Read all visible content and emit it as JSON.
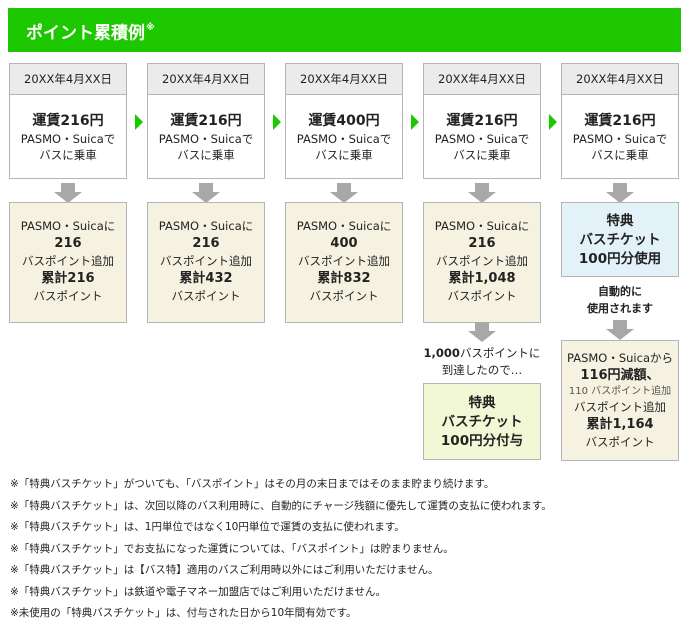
{
  "header": {
    "title": "ポイント累積例",
    "mark": "※"
  },
  "columns": [
    {
      "date": "20XX年4月XX日",
      "fare": "運賃216円",
      "line1": "PASMO・Suicaで",
      "line2": "バスに乗車",
      "r1": "PASMO・Suicaに",
      "r2": "216",
      "r3": "バスポイント追加",
      "r4": "累計216",
      "r5": "バスポイント"
    },
    {
      "date": "20XX年4月XX日",
      "fare": "運賃216円",
      "line1": "PASMO・Suicaで",
      "line2": "バスに乗車",
      "r1": "PASMO・Suicaに",
      "r2": "216",
      "r3": "バスポイント追加",
      "r4": "累計432",
      "r5": "バスポイント"
    },
    {
      "date": "20XX年4月XX日",
      "fare": "運賃400円",
      "line1": "PASMO・Suicaで",
      "line2": "バスに乗車",
      "r1": "PASMO・Suicaに",
      "r2": "400",
      "r3": "バスポイント追加",
      "r4": "累計832",
      "r5": "バスポイント"
    },
    {
      "date": "20XX年4月XX日",
      "fare": "運賃216円",
      "line1": "PASMO・Suicaで",
      "line2": "バスに乗車",
      "r1": "PASMO・Suicaに",
      "r2": "216",
      "r3": "バスポイント追加",
      "r4": "累計1,048",
      "r5": "バスポイント"
    },
    {
      "date": "20XX年4月XX日",
      "fare": "運賃216円",
      "line1": "PASMO・Suicaで",
      "line2": "バスに乗車"
    }
  ],
  "col4_extra": {
    "reach_amount": "1,000",
    "reach_text1": "バスポイントに",
    "reach_text2": "到達したので…",
    "grant1": "特典",
    "grant2": "バスチケット",
    "grant3": "100円分付与"
  },
  "col5_extra": {
    "use1": "特典",
    "use2": "バスチケット",
    "use3": "100円分使用",
    "auto1": "自動的に",
    "auto2": "使用されます",
    "f1": "PASMO・Suicaから",
    "f2": "116円減額、",
    "f3": "110 バスポイント追加",
    "f4": "バスポイント追加",
    "f5": "累計1,164",
    "f6": "バスポイント"
  },
  "notes": [
    "※「特典バスチケット」がついても、「バスポイント」はその月の末日まではそのまま貯まり続けます。",
    "※「特典バスチケット」は、次回以降のバス利用時に、自動的にチャージ残額に優先して運賃の支払に使われます。",
    "※「特典バスチケット」は、1円単位ではなく10円単位で運賃の支払に使われます。",
    "※「特典バスチケット」でお支払になった運賃については、「バスポイント」は貯まりません。",
    "※「特典バスチケット」は【バス特】適用のバスご利用時以外にはご利用いただけません。",
    "※「特典バスチケット」は鉄道や電子マネー加盟店ではご利用いただけません。",
    "※未使用の「特典バスチケット」は、付与された日から10年間有効です。"
  ],
  "colors": {
    "header_green": "#1ec800",
    "arrow_green": "#1ec800",
    "arrow_gray": "#a8a8a8",
    "result_bg": "#f5f2e1",
    "use_bg": "#e3f1f9",
    "grant_bg": "#f2f7d5"
  }
}
